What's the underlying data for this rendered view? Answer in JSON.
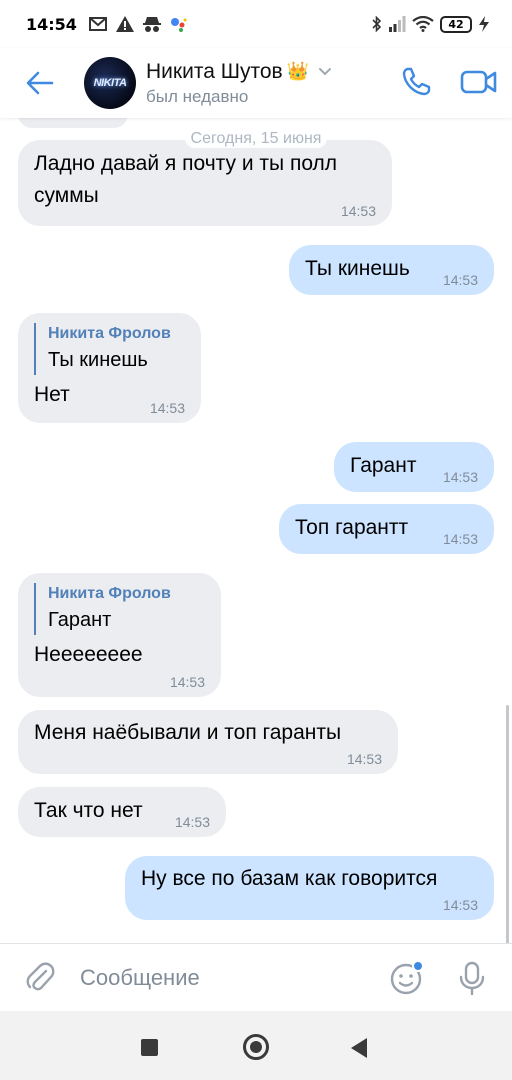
{
  "status_bar": {
    "time": "14:54",
    "battery_level": "42",
    "icons": [
      "gmail-icon",
      "warning-icon",
      "incognito-icon",
      "assistant-icon",
      "bluetooth-icon",
      "signal-icon",
      "wifi-icon",
      "battery-icon",
      "charging-icon"
    ]
  },
  "header": {
    "contact_name": "Никита Шутов",
    "crown": "👑",
    "status": "был недавно",
    "avatar_text": "NIKITA"
  },
  "chat": {
    "date_label": "Сегодня, 15 июня",
    "messages": [
      {
        "direction": "in",
        "text_line1": "Ладно давай я почту и ты полл",
        "text_line2": "суммы",
        "time": "14:53"
      },
      {
        "direction": "out",
        "text": "Ты кинешь",
        "time": "14:53"
      },
      {
        "direction": "in",
        "reply_author": "Никита Фролов",
        "reply_text": "Ты кинешь",
        "text": "Нет",
        "time": "14:53"
      },
      {
        "direction": "out",
        "text": "Гарант",
        "time": "14:53"
      },
      {
        "direction": "out",
        "text": "Топ гарантт",
        "time": "14:53"
      },
      {
        "direction": "in",
        "reply_author": "Никита Фролов",
        "reply_text": "Гарант",
        "text": "Неееееееe",
        "time": "14:53"
      },
      {
        "direction": "in",
        "text": "Меня наёбывали и топ гаранты",
        "time": "14:53"
      },
      {
        "direction": "in",
        "text": "Так что нет",
        "time": "14:53"
      },
      {
        "direction": "out",
        "text": "Ну все по базам как говорится",
        "time": "14:53"
      }
    ]
  },
  "input": {
    "placeholder": "Сообщение",
    "value": ""
  },
  "colors": {
    "accent": "#3f8ae0",
    "incoming_bubble": "#ebedf0",
    "outgoing_bubble": "#cce4ff",
    "secondary_text": "#818c99",
    "reply_author": "#5181b8"
  }
}
